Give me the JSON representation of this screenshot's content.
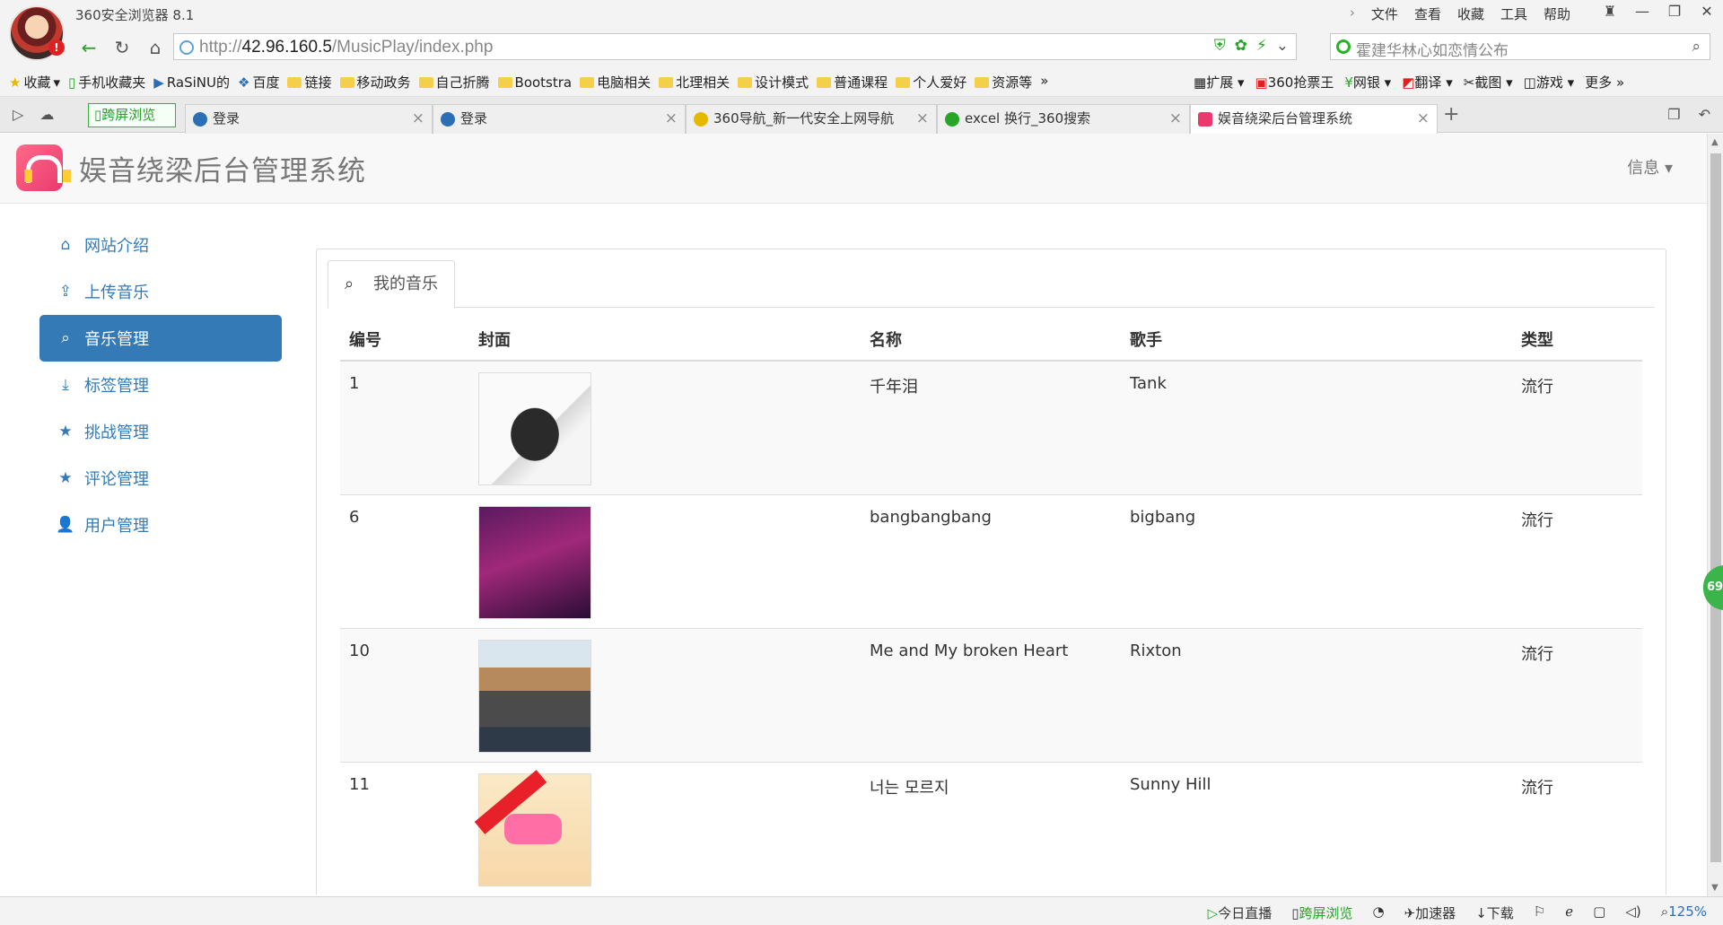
{
  "browser": {
    "app_title": "360安全浏览器 8.1",
    "menu": [
      "文件",
      "查看",
      "收藏",
      "工具",
      "帮助"
    ],
    "window_controls": [
      "shirt-icon",
      "minimize-icon",
      "maximize-icon",
      "close-icon"
    ],
    "url_prefix": "http://",
    "url_host": "42.96.160.5",
    "url_path": "/MusicPlay/index.php",
    "search_placeholder": "霍建华林心如恋情公布",
    "bookmarks": [
      "收藏",
      "手机收藏夹",
      "RaSiNU的",
      "百度",
      "链接",
      "移动政务",
      "自己折腾",
      "Bootstra",
      "电脑相关",
      "北理相关",
      "设计模式",
      "普通课程",
      "个人爱好",
      "资源等"
    ],
    "bookmarks_right": [
      "扩展",
      "360抢票王",
      "网银",
      "翻译",
      "截图",
      "游戏",
      "更多"
    ],
    "split_browse_label": "跨屏浏览",
    "tabs": [
      {
        "title": "登录",
        "color": "#2a6fb5"
      },
      {
        "title": "登录",
        "color": "#2a6fb5"
      },
      {
        "title": "360导航_新一代安全上网导航",
        "color": "#e6b800"
      },
      {
        "title": "excel 换行_360搜索",
        "color": "#27a527"
      },
      {
        "title": "娱音绕梁后台管理系统",
        "color": "#e93a6f"
      }
    ],
    "avatar_badge": "!",
    "status": {
      "live": "今日直播",
      "split": "跨屏浏览",
      "accelerator": "加速器",
      "download": "下载",
      "zoom": "125%"
    },
    "float_ball_number": "69"
  },
  "page": {
    "brand": "娱音绕梁后台管理系统",
    "info_menu": "信息",
    "sidebar": [
      {
        "label": "网站介绍",
        "icon": "home-icon",
        "glyph": "⌂",
        "active": false
      },
      {
        "label": "上传音乐",
        "icon": "upload-icon",
        "glyph": "⇪",
        "active": false
      },
      {
        "label": "音乐管理",
        "icon": "search-icon",
        "glyph": "⌕",
        "active": true
      },
      {
        "label": "标签管理",
        "icon": "download-icon",
        "glyph": "⤓",
        "active": false
      },
      {
        "label": "挑战管理",
        "icon": "star-icon",
        "glyph": "★",
        "active": false
      },
      {
        "label": "评论管理",
        "icon": "star-icon",
        "glyph": "★",
        "active": false
      },
      {
        "label": "用户管理",
        "icon": "user-icon",
        "glyph": "👤",
        "active": false
      }
    ],
    "panel_tab": "我的音乐",
    "table": {
      "headers": [
        "编号",
        "封面",
        "名称",
        "歌手",
        "类型"
      ],
      "rows": [
        {
          "id": "1",
          "name": "千年泪",
          "singer": "Tank",
          "type": "流行"
        },
        {
          "id": "6",
          "name": "bangbangbang",
          "singer": "bigbang",
          "type": "流行"
        },
        {
          "id": "10",
          "name": "Me and My broken Heart",
          "singer": "Rixton",
          "type": "流行"
        },
        {
          "id": "11",
          "name": "너는 모르지",
          "singer": "Sunny Hill",
          "type": "流行"
        }
      ]
    }
  }
}
